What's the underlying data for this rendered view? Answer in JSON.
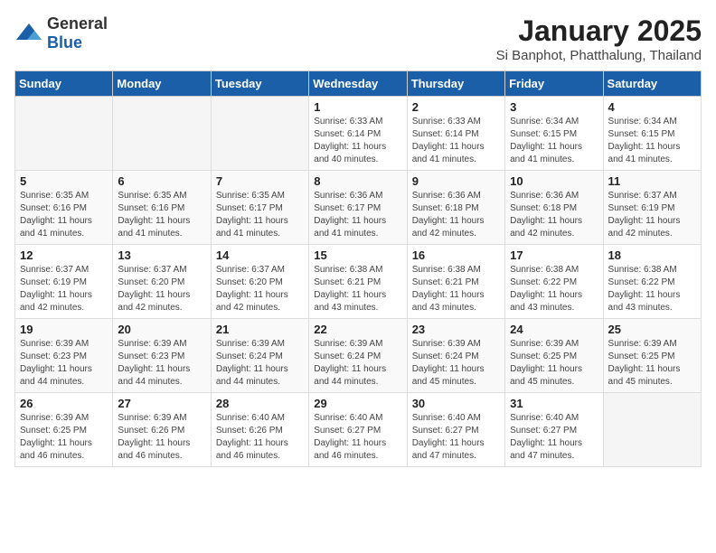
{
  "logo": {
    "general": "General",
    "blue": "Blue"
  },
  "title": "January 2025",
  "subtitle": "Si Banphot, Phatthalung, Thailand",
  "days_of_week": [
    "Sunday",
    "Monday",
    "Tuesday",
    "Wednesday",
    "Thursday",
    "Friday",
    "Saturday"
  ],
  "weeks": [
    [
      {
        "day": "",
        "info": ""
      },
      {
        "day": "",
        "info": ""
      },
      {
        "day": "",
        "info": ""
      },
      {
        "day": "1",
        "info": "Sunrise: 6:33 AM\nSunset: 6:14 PM\nDaylight: 11 hours\nand 40 minutes."
      },
      {
        "day": "2",
        "info": "Sunrise: 6:33 AM\nSunset: 6:14 PM\nDaylight: 11 hours\nand 41 minutes."
      },
      {
        "day": "3",
        "info": "Sunrise: 6:34 AM\nSunset: 6:15 PM\nDaylight: 11 hours\nand 41 minutes."
      },
      {
        "day": "4",
        "info": "Sunrise: 6:34 AM\nSunset: 6:15 PM\nDaylight: 11 hours\nand 41 minutes."
      }
    ],
    [
      {
        "day": "5",
        "info": "Sunrise: 6:35 AM\nSunset: 6:16 PM\nDaylight: 11 hours\nand 41 minutes."
      },
      {
        "day": "6",
        "info": "Sunrise: 6:35 AM\nSunset: 6:16 PM\nDaylight: 11 hours\nand 41 minutes."
      },
      {
        "day": "7",
        "info": "Sunrise: 6:35 AM\nSunset: 6:17 PM\nDaylight: 11 hours\nand 41 minutes."
      },
      {
        "day": "8",
        "info": "Sunrise: 6:36 AM\nSunset: 6:17 PM\nDaylight: 11 hours\nand 41 minutes."
      },
      {
        "day": "9",
        "info": "Sunrise: 6:36 AM\nSunset: 6:18 PM\nDaylight: 11 hours\nand 42 minutes."
      },
      {
        "day": "10",
        "info": "Sunrise: 6:36 AM\nSunset: 6:18 PM\nDaylight: 11 hours\nand 42 minutes."
      },
      {
        "day": "11",
        "info": "Sunrise: 6:37 AM\nSunset: 6:19 PM\nDaylight: 11 hours\nand 42 minutes."
      }
    ],
    [
      {
        "day": "12",
        "info": "Sunrise: 6:37 AM\nSunset: 6:19 PM\nDaylight: 11 hours\nand 42 minutes."
      },
      {
        "day": "13",
        "info": "Sunrise: 6:37 AM\nSunset: 6:20 PM\nDaylight: 11 hours\nand 42 minutes."
      },
      {
        "day": "14",
        "info": "Sunrise: 6:37 AM\nSunset: 6:20 PM\nDaylight: 11 hours\nand 42 minutes."
      },
      {
        "day": "15",
        "info": "Sunrise: 6:38 AM\nSunset: 6:21 PM\nDaylight: 11 hours\nand 43 minutes."
      },
      {
        "day": "16",
        "info": "Sunrise: 6:38 AM\nSunset: 6:21 PM\nDaylight: 11 hours\nand 43 minutes."
      },
      {
        "day": "17",
        "info": "Sunrise: 6:38 AM\nSunset: 6:22 PM\nDaylight: 11 hours\nand 43 minutes."
      },
      {
        "day": "18",
        "info": "Sunrise: 6:38 AM\nSunset: 6:22 PM\nDaylight: 11 hours\nand 43 minutes."
      }
    ],
    [
      {
        "day": "19",
        "info": "Sunrise: 6:39 AM\nSunset: 6:23 PM\nDaylight: 11 hours\nand 44 minutes."
      },
      {
        "day": "20",
        "info": "Sunrise: 6:39 AM\nSunset: 6:23 PM\nDaylight: 11 hours\nand 44 minutes."
      },
      {
        "day": "21",
        "info": "Sunrise: 6:39 AM\nSunset: 6:24 PM\nDaylight: 11 hours\nand 44 minutes."
      },
      {
        "day": "22",
        "info": "Sunrise: 6:39 AM\nSunset: 6:24 PM\nDaylight: 11 hours\nand 44 minutes."
      },
      {
        "day": "23",
        "info": "Sunrise: 6:39 AM\nSunset: 6:24 PM\nDaylight: 11 hours\nand 45 minutes."
      },
      {
        "day": "24",
        "info": "Sunrise: 6:39 AM\nSunset: 6:25 PM\nDaylight: 11 hours\nand 45 minutes."
      },
      {
        "day": "25",
        "info": "Sunrise: 6:39 AM\nSunset: 6:25 PM\nDaylight: 11 hours\nand 45 minutes."
      }
    ],
    [
      {
        "day": "26",
        "info": "Sunrise: 6:39 AM\nSunset: 6:25 PM\nDaylight: 11 hours\nand 46 minutes."
      },
      {
        "day": "27",
        "info": "Sunrise: 6:39 AM\nSunset: 6:26 PM\nDaylight: 11 hours\nand 46 minutes."
      },
      {
        "day": "28",
        "info": "Sunrise: 6:40 AM\nSunset: 6:26 PM\nDaylight: 11 hours\nand 46 minutes."
      },
      {
        "day": "29",
        "info": "Sunrise: 6:40 AM\nSunset: 6:27 PM\nDaylight: 11 hours\nand 46 minutes."
      },
      {
        "day": "30",
        "info": "Sunrise: 6:40 AM\nSunset: 6:27 PM\nDaylight: 11 hours\nand 47 minutes."
      },
      {
        "day": "31",
        "info": "Sunrise: 6:40 AM\nSunset: 6:27 PM\nDaylight: 11 hours\nand 47 minutes."
      },
      {
        "day": "",
        "info": ""
      }
    ]
  ]
}
